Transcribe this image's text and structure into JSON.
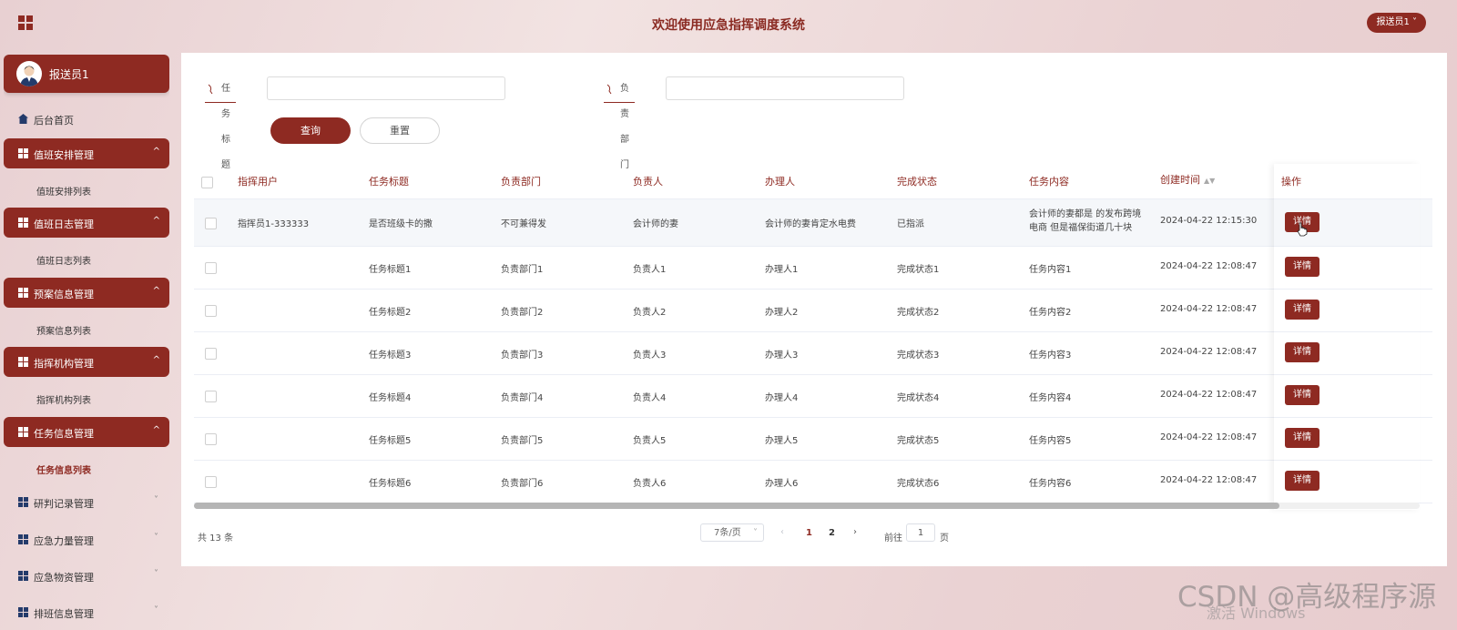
{
  "header": {
    "title": "欢迎使用应急指挥调度系统",
    "user_menu": "报送员1 ˅"
  },
  "sidebar": {
    "profile_name": "报送员1",
    "home": "后台首页",
    "groups": [
      {
        "label": "值班安排管理",
        "sub": "值班安排列表"
      },
      {
        "label": "值班日志管理",
        "sub": "值班日志列表"
      },
      {
        "label": "预案信息管理",
        "sub": "预案信息列表"
      },
      {
        "label": "指挥机构管理",
        "sub": "指挥机构列表"
      },
      {
        "label": "任务信息管理",
        "sub": "任务信息列表"
      }
    ],
    "collapsed": [
      "研判记录管理",
      "应急力量管理",
      "应急物资管理",
      "排班信息管理"
    ]
  },
  "search": {
    "title_label": "任务标题",
    "title_value": "",
    "dept_label": "负责部门",
    "dept_value": "",
    "query_btn": "查询",
    "reset_btn": "重置"
  },
  "table": {
    "headers": [
      "指挥用户",
      "任务标题",
      "负责部门",
      "负责人",
      "办理人",
      "完成状态",
      "任务内容",
      "创建时间",
      "操作"
    ],
    "detail_label": "详情",
    "rows": [
      {
        "user": "指挥员1-333333",
        "title": "是否班级卡的撒",
        "dept": "不可兼得发",
        "lead": "会计师的妻",
        "handler": "会计师的妻肯定水电费",
        "status": "已指派",
        "content": "会计师的妻都是 的发布跨境电商 但是福保街道几十块",
        "created": "2024-04-22 12:15:30"
      },
      {
        "user": "",
        "title": "任务标题1",
        "dept": "负责部门1",
        "lead": "负责人1",
        "handler": "办理人1",
        "status": "完成状态1",
        "content": "任务内容1",
        "created": "2024-04-22 12:08:47"
      },
      {
        "user": "",
        "title": "任务标题2",
        "dept": "负责部门2",
        "lead": "负责人2",
        "handler": "办理人2",
        "status": "完成状态2",
        "content": "任务内容2",
        "created": "2024-04-22 12:08:47"
      },
      {
        "user": "",
        "title": "任务标题3",
        "dept": "负责部门3",
        "lead": "负责人3",
        "handler": "办理人3",
        "status": "完成状态3",
        "content": "任务内容3",
        "created": "2024-04-22 12:08:47"
      },
      {
        "user": "",
        "title": "任务标题4",
        "dept": "负责部门4",
        "lead": "负责人4",
        "handler": "办理人4",
        "status": "完成状态4",
        "content": "任务内容4",
        "created": "2024-04-22 12:08:47"
      },
      {
        "user": "",
        "title": "任务标题5",
        "dept": "负责部门5",
        "lead": "负责人5",
        "handler": "办理人5",
        "status": "完成状态5",
        "content": "任务内容5",
        "created": "2024-04-22 12:08:47"
      },
      {
        "user": "",
        "title": "任务标题6",
        "dept": "负责部门6",
        "lead": "负责人6",
        "handler": "办理人6",
        "status": "完成状态6",
        "content": "任务内容6",
        "created": "2024-04-22 12:08:47"
      }
    ]
  },
  "pager": {
    "total": "共 13 条",
    "page_size": "7条/页",
    "pages": [
      "1",
      "2"
    ],
    "goto_prefix": "前往",
    "goto_value": "1",
    "goto_suffix": "页"
  },
  "overlay": {
    "watermark": "CSDN @高级程序源",
    "activate": "激活 Windows"
  },
  "colors": {
    "accent": "#8e2a22"
  }
}
